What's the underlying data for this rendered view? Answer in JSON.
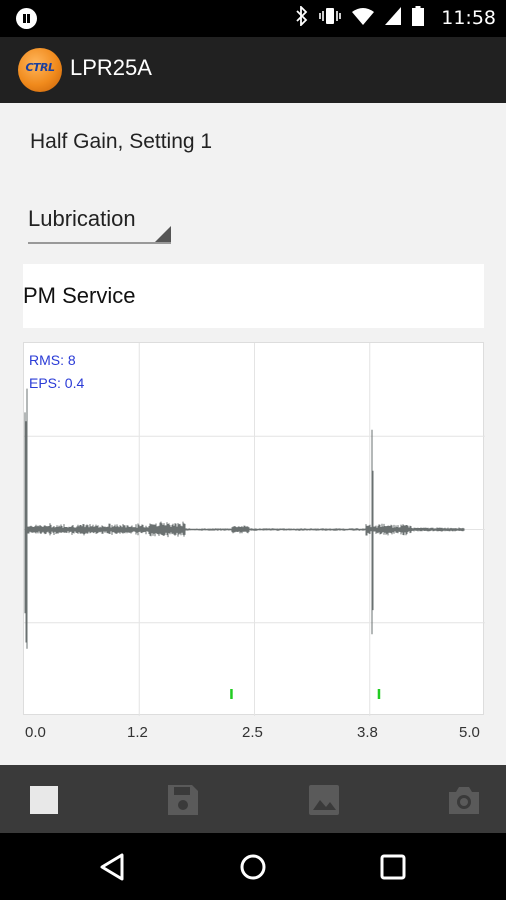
{
  "status": {
    "time": "11:58"
  },
  "app": {
    "title": "LPR25A",
    "logo_text": "CTRL"
  },
  "header": {
    "subtitle": "Half Gain, Setting 1"
  },
  "category": {
    "selected": "Lubrication"
  },
  "note": {
    "text": "PM Service"
  },
  "chart_data": {
    "type": "line",
    "x_ticks": [
      "0.0",
      "1.2",
      "2.5",
      "3.8",
      "5.0"
    ],
    "xlim": [
      0,
      5
    ],
    "annotations": {
      "rms": "RMS: 8",
      "eps": "EPS: 0.4"
    },
    "grid": true,
    "event_markers_x": [
      2.25,
      3.85
    ],
    "color": "#6a7070",
    "marker_color": "#22cc22"
  },
  "toolbar": {
    "icons": [
      "stop-icon",
      "save-icon",
      "image-icon",
      "camera-icon"
    ]
  },
  "nav": {
    "icons": [
      "back-icon",
      "home-icon",
      "recents-icon"
    ]
  },
  "colors": {
    "appbar": "#212121",
    "statusbar": "#000000",
    "accent": "#f08a1c",
    "stat_text": "#2a3bd6"
  }
}
